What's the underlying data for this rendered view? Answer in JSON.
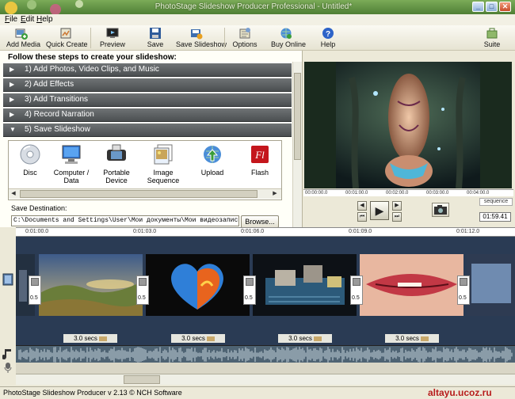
{
  "window": {
    "title": "PhotoStage Slideshow Producer Professional - Untitled*",
    "controls": {
      "minimize": "_",
      "maximize": "□",
      "close": "✕"
    }
  },
  "menu": [
    {
      "label": "File",
      "u": "F",
      "rest": "ile"
    },
    {
      "label": "Edit",
      "u": "E",
      "rest": "dit"
    },
    {
      "label": "Help",
      "u": "H",
      "rest": "elp"
    }
  ],
  "toolbar": {
    "add_media": "Add Media",
    "quick_create": "Quick Create",
    "preview": "Preview",
    "save": "Save",
    "save_slideshow": "Save Slideshow",
    "options": "Options",
    "buy_online": "Buy Online",
    "help": "Help",
    "suite": "Suite"
  },
  "steps": {
    "title": "Follow these steps to create your slideshow:",
    "items": [
      {
        "label": "1)   Add Photos, Video Clips, and Music",
        "state": "collapsed"
      },
      {
        "label": "2)   Add Effects",
        "state": "collapsed"
      },
      {
        "label": "3)   Add Transitions",
        "state": "collapsed"
      },
      {
        "label": "4)   Record Narration",
        "state": "collapsed"
      },
      {
        "label": "5)   Save Slideshow",
        "state": "expanded"
      }
    ]
  },
  "save_options": [
    {
      "label": "Disc"
    },
    {
      "label": "Computer / Data"
    },
    {
      "label": "Portable Device"
    },
    {
      "label": "Image Sequence"
    },
    {
      "label": "Upload"
    },
    {
      "label": "Flash"
    }
  ],
  "destination": {
    "label": "Save Destination:",
    "value": "C:\\Documents and Settings\\User\\Мои документы\\Мои видеозаписи\\video.swf",
    "browse": "Browse..."
  },
  "preview": {
    "timeline_labels": [
      "00:00:00.0",
      "00:01:00.0",
      "00:02:00.0",
      "00:03:00.0",
      "00:04:00.0"
    ],
    "sequence_tab": "sequence",
    "timecode": "01:59.41"
  },
  "timeline": {
    "ruler": [
      "0:01:00.0",
      "0:01:03.0",
      "0:01:06.0",
      "0:01:09.0",
      "0:01:12.0"
    ],
    "transitions": [
      "0.5",
      "0.5",
      "0.5",
      "0.5",
      "0.5"
    ],
    "durations": [
      "3.0 secs",
      "3.0 secs",
      "3.0 secs",
      "3.0 secs"
    ]
  },
  "status": {
    "text": "PhotoStage Slideshow Producer v 2.13 © NCH Software",
    "watermark": "altayu.ucoz.ru"
  },
  "colors": {
    "title_bar": "#5b8a3f",
    "step_bar": "#5d6163",
    "track_bg": "#2a3b54",
    "watermark": "#b71c1c"
  }
}
